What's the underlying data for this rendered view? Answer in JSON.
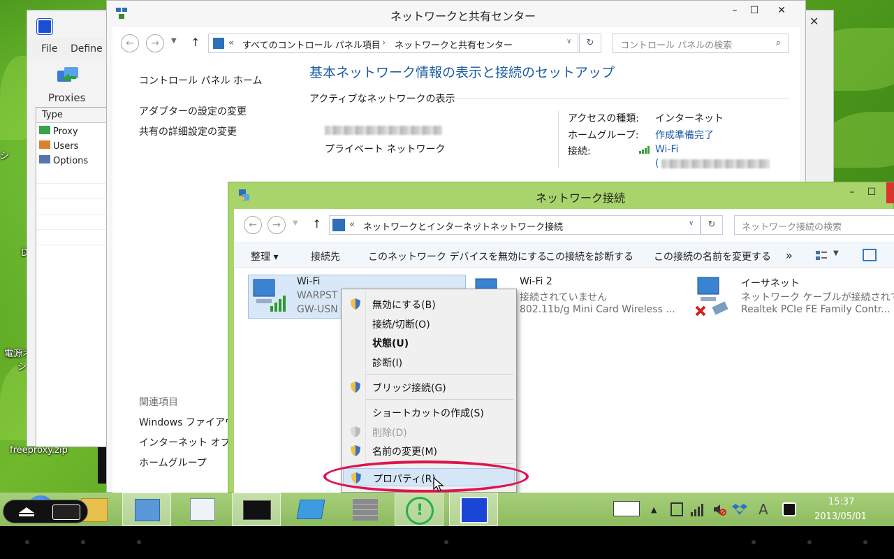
{
  "desktop": {
    "file_label": "freeproxy.zip",
    "partial_labels": [
      "シ",
      "D",
      "電源オ",
      "シ"
    ]
  },
  "proxy_app": {
    "menu": [
      "File",
      "Define"
    ],
    "toolbar_label": "Proxies",
    "column_header": "Type",
    "items": [
      "Proxy",
      "Users",
      "Options"
    ]
  },
  "nsc": {
    "title": "ネットワークと共有センター",
    "controls": [
      "–",
      "☐",
      "✕"
    ],
    "breadcrumb": [
      "すべてのコントロール パネル項目",
      "ネットワークと共有センター"
    ],
    "breadcrumb_prefix": "«",
    "search_placeholder": "コントロール パネルの検索",
    "sidebar_home": "コントロール パネル ホーム",
    "sidebar_links": [
      "アダプターの設定の変更",
      "共有の詳細設定の変更"
    ],
    "related_header": "関連項目",
    "related_links": [
      "Windows ファイアウォ",
      "インターネット オプショ",
      "ホームグループ"
    ],
    "heading": "基本ネットワーク情報の表示と接続のセットアップ",
    "section": "アクティブなネットワークの表示",
    "network_type": "プライベート ネットワーク",
    "access_type_label": "アクセスの種類:",
    "access_type_value": "インターネット",
    "homegroup_label": "ホームグループ:",
    "homegroup_value": "作成準備完了",
    "connection_label": "接続:",
    "connection_value": "Wi-Fi",
    "connection_paren": "("
  },
  "netconn": {
    "title": "ネットワーク接続",
    "controls": [
      "–",
      "☐"
    ],
    "breadcrumb": [
      "ネットワークとインターネット",
      "ネットワーク接続"
    ],
    "breadcrumb_prefix": "«",
    "search_placeholder": "ネットワーク接続の検索",
    "toolbar": {
      "organize": "整理 ▾",
      "connect": "接続先",
      "disable": "このネットワーク デバイスを無効にする",
      "diagnose": "この接続を診断する",
      "rename": "この接続の名前を変更する",
      "more": "»"
    },
    "adapters": [
      {
        "name": "Wi-Fi",
        "line1": "WARPST",
        "line2": "GW-USN"
      },
      {
        "name": "Wi-Fi 2",
        "line1": "接続されていません",
        "line2": "802.11b/g Mini Card Wireless ..."
      },
      {
        "name": "イーサネット",
        "line1": "ネットワーク ケーブルが接続されていま",
        "line2": "Realtek PCIe FE Family Contr..."
      }
    ]
  },
  "context_menu": [
    {
      "label": "無効にする(B)",
      "shield": true,
      "style": "normal"
    },
    {
      "label": "接続/切断(O)",
      "shield": false,
      "style": "normal"
    },
    {
      "label": "状態(U)",
      "shield": false,
      "style": "bold"
    },
    {
      "label": "診断(I)",
      "shield": false,
      "style": "normal"
    },
    {
      "label": "ブリッジ接続(G)",
      "shield": true,
      "style": "normal"
    },
    {
      "label": "ショートカットの作成(S)",
      "shield": false,
      "style": "normal"
    },
    {
      "label": "削除(D)",
      "shield": true,
      "style": "disabled"
    },
    {
      "label": "名前の変更(M)",
      "shield": true,
      "style": "normal"
    },
    {
      "label": "プロパティ(R)",
      "shield": true,
      "style": "highlighted"
    }
  ],
  "taskbar": {
    "time": "15:37",
    "date": "2013/05/01",
    "ime": "A",
    "tray_expand": "▲"
  },
  "colors": {
    "accent_title": "#1c5da3",
    "highlight_ring": "#e0134f",
    "taskbar": "#9cc56f",
    "netconn_titlebar": "#a9d46c"
  }
}
